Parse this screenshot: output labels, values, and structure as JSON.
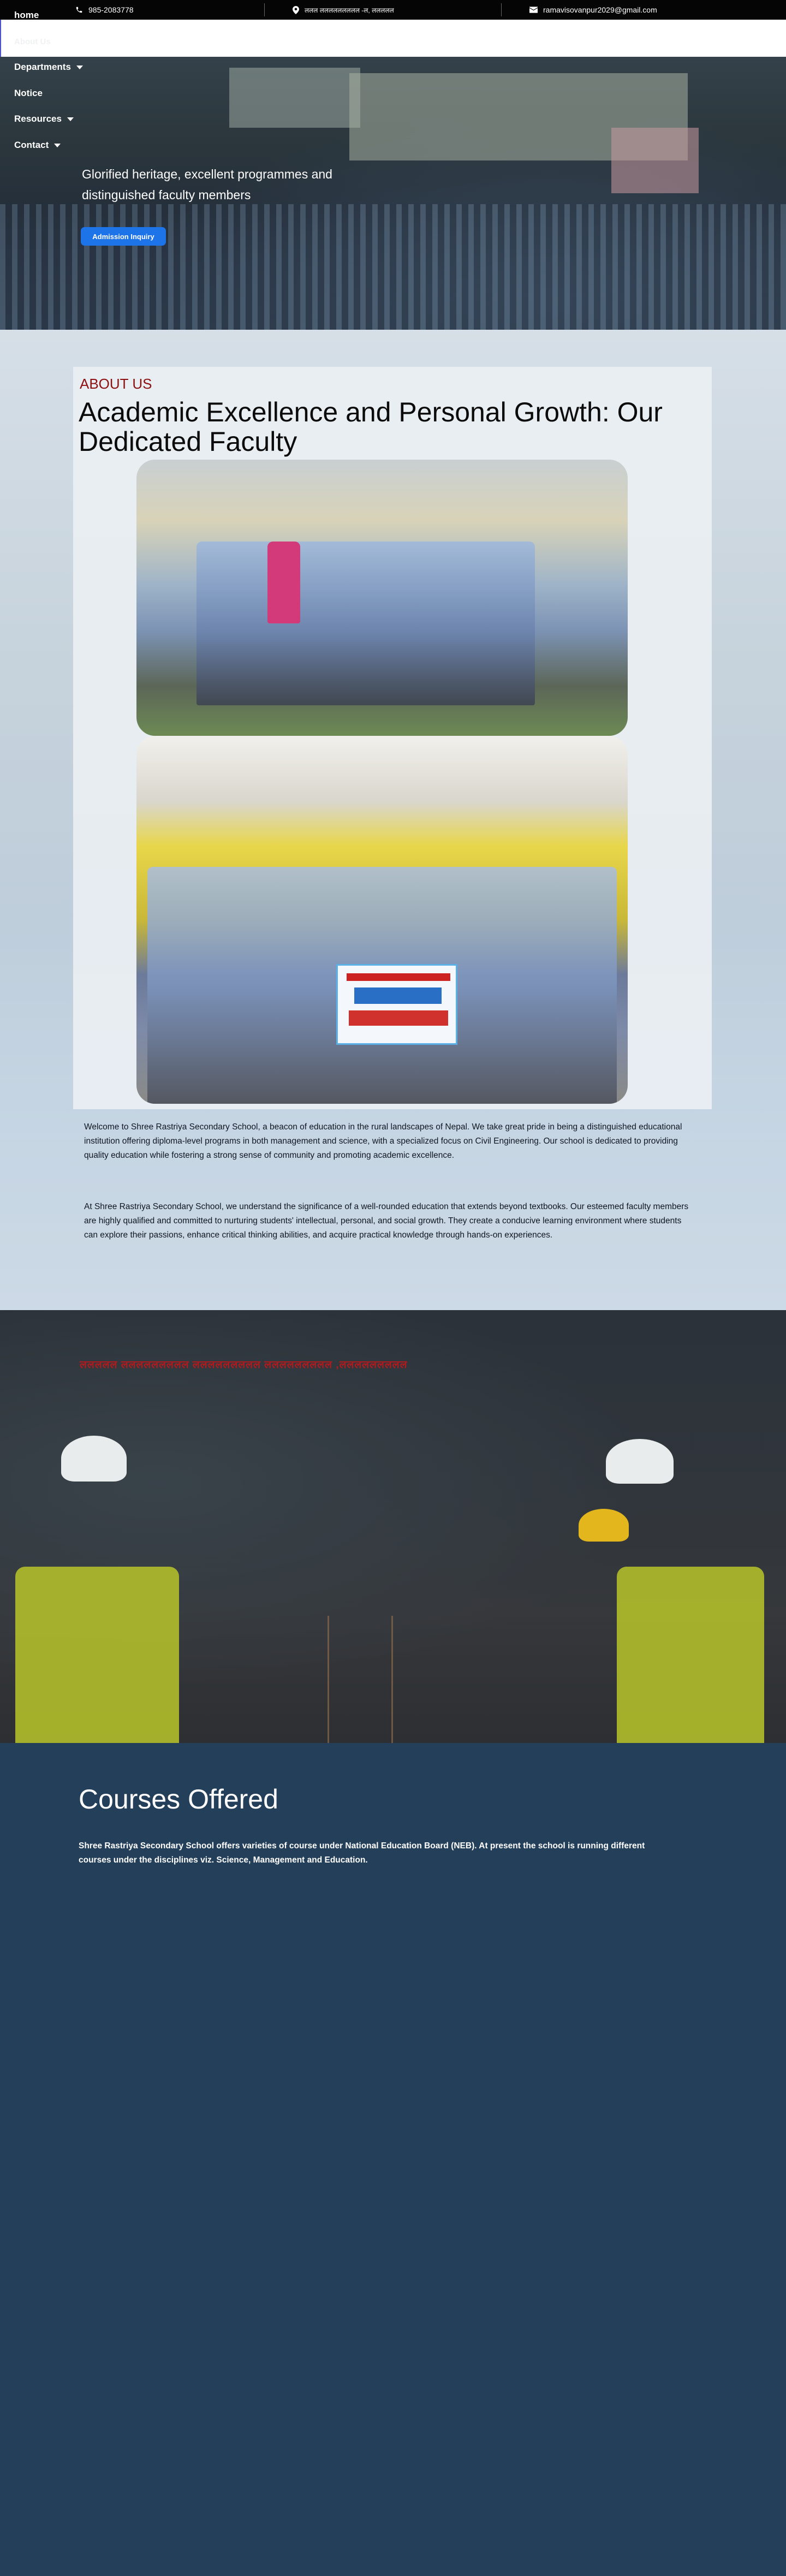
{
  "topbar": {
    "phone": "985-2083778",
    "address": "ललल ललललललललल -ल, ललललल",
    "email": "ramavisovanpur2029@gmail.com"
  },
  "nav": {
    "home": "home",
    "about": "About Us",
    "departments": "Departments",
    "notice": "Notice",
    "resources": "Resources",
    "contact": "Contact"
  },
  "hero": {
    "tagline": "Glorified heritage, excellent programmes and distinguished faculty members",
    "button": "Admission Inquiry"
  },
  "about": {
    "eyebrow": "ABOUT US",
    "title": "Academic Excellence and Personal Growth: Our Dedicated Faculty",
    "paragraph1": "Welcome to Shree Rastriya Secondary School, a beacon of education in the rural landscapes of Nepal. We take great pride in being a distinguished educational institution offering diploma-level programs in both management and science, with a specialized focus on Civil Engineering. Our school is dedicated to providing quality education while fostering a strong sense of community and promoting academic excellence.",
    "paragraph2": "At Shree Rastriya Secondary School, we understand the significance of a well-rounded education that extends beyond textbooks. Our esteemed faculty members are highly qualified and committed to nurturing students' intellectual, personal, and social growth. They create a conducive learning environment where students can explore their passions, enhance critical thinking abilities, and acquire practical knowledge through hands-on experiences."
  },
  "engineering": {
    "heading": "ललललल ललललललललल ललललललललल ललललललललल ,ललललललललल"
  },
  "courses": {
    "title": "Courses Offered",
    "text": "Shree Rastriya Secondary School offers varieties of course under National Education Board (NEB). At present the school is running different courses under the disciplines viz. Science, Management  and Education."
  },
  "colors": {
    "accent_red": "#8d0f0f",
    "button_blue": "#1d73e8",
    "courses_bg": "#233f59",
    "topbar_bg": "#050505"
  },
  "icons": [
    "phone-icon",
    "location-pin-icon",
    "email-icon",
    "caret-down-icon"
  ]
}
